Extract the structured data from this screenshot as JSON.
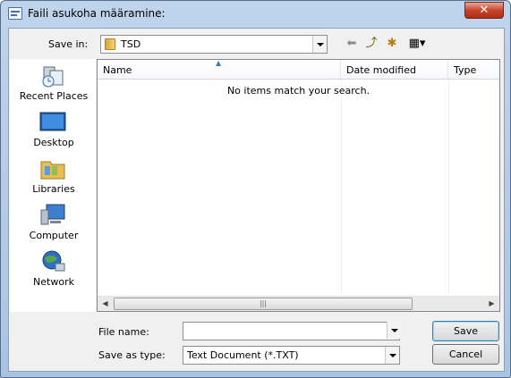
{
  "window": {
    "title": "Faili asukoha määramine:",
    "close_glyph": "✕"
  },
  "save_in": {
    "label": "Save in:",
    "value": "TSD"
  },
  "toolbar": {
    "back_glyph": "⬅",
    "up_glyph": "⤴",
    "new_folder_glyph": "✱",
    "views_glyph": "▦▾"
  },
  "places": [
    {
      "label": "Recent Places",
      "icon": "recent-places-icon"
    },
    {
      "label": "Desktop",
      "icon": "desktop-icon"
    },
    {
      "label": "Libraries",
      "icon": "libraries-icon"
    },
    {
      "label": "Computer",
      "icon": "computer-icon"
    },
    {
      "label": "Network",
      "icon": "network-icon"
    }
  ],
  "filelist": {
    "columns": [
      "Name",
      "Date modified",
      "Type"
    ],
    "sort_caret": "▲",
    "empty_message": "No items match your search.",
    "scroll_left": "◀",
    "scroll_right": "▶",
    "thumb_grip": "|||"
  },
  "file_name": {
    "label": "File name:",
    "value": ""
  },
  "save_as_type": {
    "label": "Save as type:",
    "value": "Text Document (*.TXT)"
  },
  "buttons": {
    "save": "Save",
    "cancel": "Cancel"
  }
}
